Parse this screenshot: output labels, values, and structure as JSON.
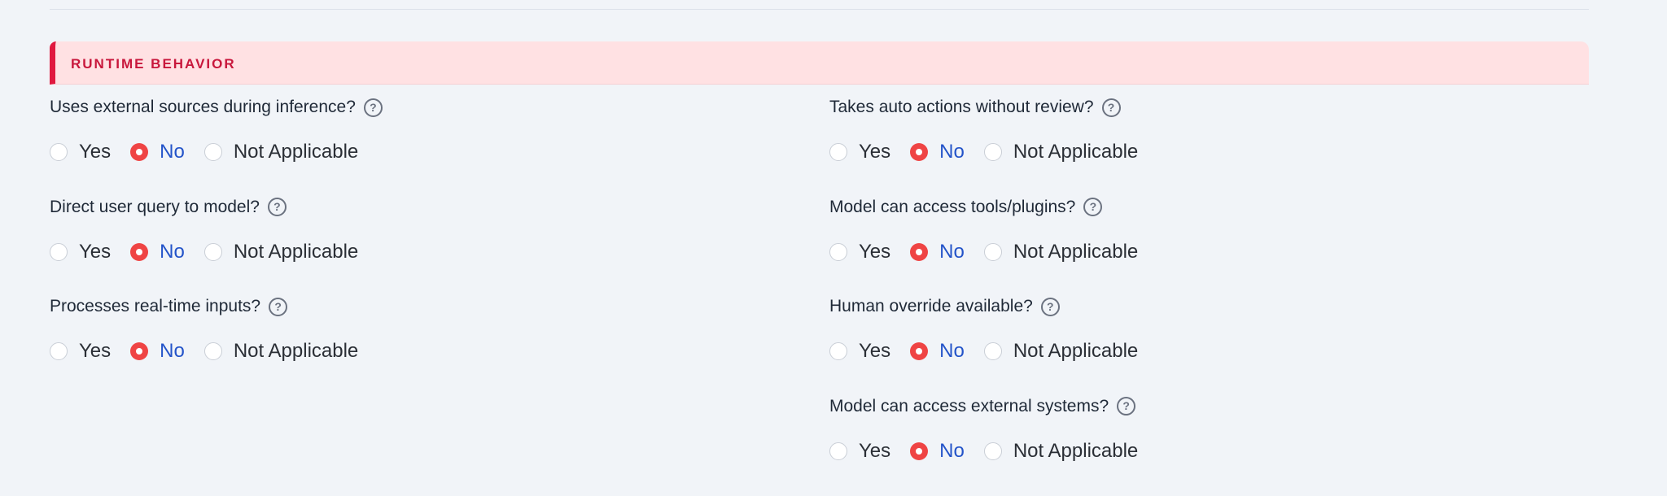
{
  "section": {
    "title": "RUNTIME BEHAVIOR"
  },
  "options": {
    "yes": "Yes",
    "no": "No",
    "na": "Not Applicable"
  },
  "left_questions": [
    {
      "label": "Uses external sources during inference?",
      "selected": "no"
    },
    {
      "label": "Direct user query to model?",
      "selected": "no"
    },
    {
      "label": "Processes real-time inputs?",
      "selected": "no"
    }
  ],
  "right_questions": [
    {
      "label": "Takes auto actions without review?",
      "selected": "no"
    },
    {
      "label": "Model can access tools/plugins?",
      "selected": "no"
    },
    {
      "label": "Human override available?",
      "selected": "no"
    },
    {
      "label": "Model can access external systems?",
      "selected": "no"
    }
  ],
  "colors": {
    "accent_red": "#e0183f",
    "selected_radio": "#ef4444",
    "selected_text": "#2454c9"
  }
}
